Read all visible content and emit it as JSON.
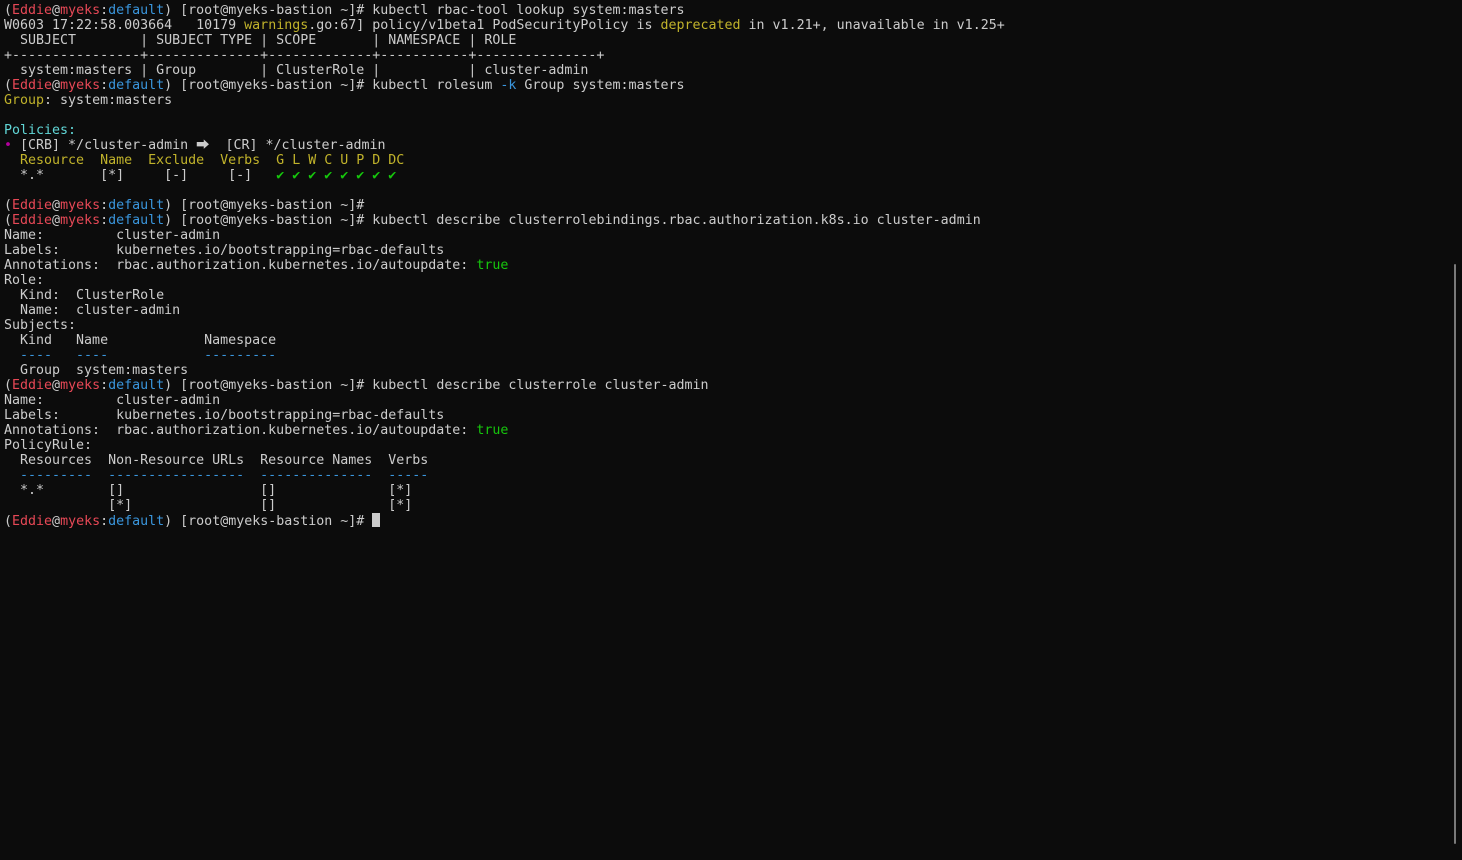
{
  "terminal": {
    "prompt": {
      "open": "(",
      "user": "Eddie",
      "at": "@",
      "host": "myeks",
      "colon": ":",
      "namespace": "default",
      "rest": ") [root@myeks-bastion ~]# "
    },
    "cmd1": "kubectl rbac-tool lookup system:masters",
    "warn": {
      "a": "W0603 17:22:58.003664   10179 ",
      "b": "warnings",
      "c": ".go:67] policy/v1beta1 PodSecurityPolicy is ",
      "d": "deprecated",
      "e": " in v1.21+, unavailable in v1.25+"
    },
    "lookup_table": {
      "header": "  SUBJECT        | SUBJECT TYPE | SCOPE       | NAMESPACE | ROLE",
      "separator": "+----------------+--------------+-------------+-----------+---------------+",
      "row": "  system:masters | Group        | ClusterRole |           | cluster-admin"
    },
    "cmd2_a": "kubectl rolesum ",
    "cmd2_flag": "-k",
    "cmd2_b": " Group system:masters",
    "rolesum": {
      "group_label": "Group",
      "group_value": ": system:masters",
      "policies_label": "Policies:",
      "bullet": "•",
      "binding": " [CRB] */cluster-admin ⮕  [CR] */cluster-admin",
      "table_header": "  Resource  Name  Exclude  Verbs  G L W C U P D DC",
      "row_resource": "  *.*       [*]     [-]     [-]   ",
      "row_checks": "✔ ✔ ✔ ✔ ✔ ✔ ✔ ✔"
    },
    "cmd3_suffix": "#",
    "cmd4": "kubectl describe clusterrolebindings.rbac.authorization.k8s.io cluster-admin",
    "crb": {
      "name": "Name:         cluster-admin",
      "labels": "Labels:       kubernetes.io/bootstrapping=rbac-defaults",
      "annotations_a": "Annotations:  rbac.authorization.kubernetes.io/autoupdate: ",
      "annotations_b": "true",
      "role": "Role:",
      "role_kind": "  Kind:  ClusterRole",
      "role_name": "  Name:  cluster-admin",
      "subjects": "Subjects:",
      "subj_header": "  Kind   Name            Namespace",
      "subj_sep": "  ----   ----            ---------",
      "subj_row": "  Group  system:masters"
    },
    "cmd5": "kubectl describe clusterrole cluster-admin",
    "cr": {
      "name": "Name:         cluster-admin",
      "labels": "Labels:       kubernetes.io/bootstrapping=rbac-defaults",
      "annotations_a": "Annotations:  rbac.authorization.kubernetes.io/autoupdate: ",
      "annotations_b": "true",
      "policyrule": "PolicyRule:",
      "pr_header": "  Resources  Non-Resource URLs  Resource Names  Verbs",
      "pr_sep": "  ---------  -----------------  --------------  -----",
      "pr_row1": "  *.*        []                 []              [*]",
      "pr_row2": "             [*]                []              [*]"
    }
  }
}
